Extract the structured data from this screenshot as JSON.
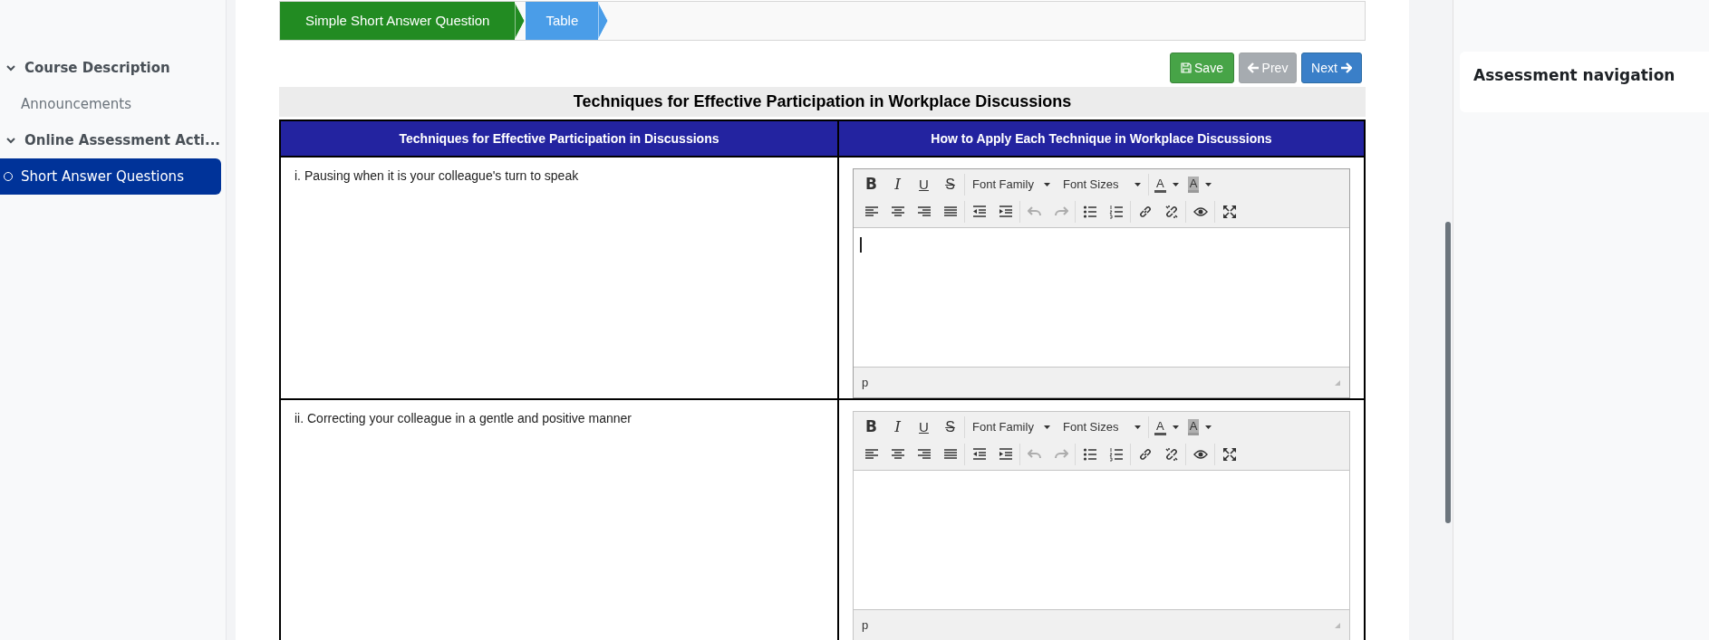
{
  "sidebar": {
    "items": [
      {
        "kind": "section",
        "label": "Course Description",
        "expanded": true
      },
      {
        "kind": "link",
        "label": "Announcements",
        "selected": false
      },
      {
        "kind": "section",
        "label": "Online Assessment Acti...",
        "expanded": true
      },
      {
        "kind": "link",
        "label": "Short Answer Questions",
        "selected": true
      }
    ]
  },
  "breadcrumb": [
    {
      "label": "Simple Short Answer Question",
      "color": "#228b22"
    },
    {
      "label": "Table",
      "color": "#4a9de8"
    }
  ],
  "actions": [
    {
      "kind": "save",
      "label": "Save",
      "disabled": false
    },
    {
      "kind": "prev",
      "label": "Prev",
      "disabled": true
    },
    {
      "kind": "next",
      "label": "Next",
      "disabled": false
    }
  ],
  "table": {
    "title": "Techniques for Effective Participation in Workplace Discussions",
    "columns": [
      "Techniques for Effective Participation in Discussions",
      "How to Apply Each Technique in Workplace Discussions"
    ],
    "rows": [
      {
        "technique": "i. Pausing when it is your colleague's turn to speak",
        "editor": {
          "focused": true,
          "status_path": "p",
          "toolbar": [
            [
              [
                {
                  "kind": "bold",
                  "label": "B",
                  "disabled": false
                },
                {
                  "kind": "italic",
                  "label": "I",
                  "disabled": false
                },
                {
                  "kind": "underline",
                  "label": "U",
                  "disabled": false
                },
                {
                  "kind": "strike",
                  "label": "S",
                  "disabled": false
                }
              ],
              [
                {
                  "kind": "dropdown",
                  "label": "Font Family",
                  "disabled": false
                },
                {
                  "kind": "dropdown",
                  "label": "Font Sizes",
                  "disabled": false
                }
              ],
              [
                {
                  "kind": "text-color",
                  "label": "A",
                  "disabled": false
                },
                {
                  "kind": "back-color",
                  "label": "A",
                  "disabled": false
                }
              ]
            ],
            [
              [
                {
                  "kind": "align-left",
                  "disabled": false
                },
                {
                  "kind": "align-center",
                  "disabled": false
                },
                {
                  "kind": "align-right",
                  "disabled": false
                },
                {
                  "kind": "justify",
                  "disabled": false
                }
              ],
              [
                {
                  "kind": "outdent",
                  "disabled": false
                },
                {
                  "kind": "indent",
                  "disabled": false
                }
              ],
              [
                {
                  "kind": "undo",
                  "disabled": true
                },
                {
                  "kind": "redo",
                  "disabled": true
                }
              ],
              [
                {
                  "kind": "bullet-list",
                  "disabled": false
                },
                {
                  "kind": "numbered-list",
                  "disabled": false
                }
              ],
              [
                {
                  "kind": "link",
                  "disabled": false
                },
                {
                  "kind": "unlink",
                  "disabled": false
                }
              ],
              [
                {
                  "kind": "preview",
                  "disabled": false
                }
              ],
              [
                {
                  "kind": "fullscreen",
                  "disabled": false
                }
              ]
            ]
          ]
        }
      },
      {
        "technique": "ii. Correcting your colleague in a gentle and positive manner",
        "editor": {
          "focused": false,
          "status_path": "p",
          "toolbar": [
            [
              [
                {
                  "kind": "bold",
                  "label": "B",
                  "disabled": false
                },
                {
                  "kind": "italic",
                  "label": "I",
                  "disabled": false
                },
                {
                  "kind": "underline",
                  "label": "U",
                  "disabled": false
                },
                {
                  "kind": "strike",
                  "label": "S",
                  "disabled": false
                }
              ],
              [
                {
                  "kind": "dropdown",
                  "label": "Font Family",
                  "disabled": false
                },
                {
                  "kind": "dropdown",
                  "label": "Font Sizes",
                  "disabled": false
                }
              ],
              [
                {
                  "kind": "text-color",
                  "label": "A",
                  "disabled": false
                },
                {
                  "kind": "back-color",
                  "label": "A",
                  "disabled": false
                }
              ]
            ],
            [
              [
                {
                  "kind": "align-left",
                  "disabled": false
                },
                {
                  "kind": "align-center",
                  "disabled": false
                },
                {
                  "kind": "align-right",
                  "disabled": false
                },
                {
                  "kind": "justify",
                  "disabled": false
                }
              ],
              [
                {
                  "kind": "outdent",
                  "disabled": false
                },
                {
                  "kind": "indent",
                  "disabled": false
                }
              ],
              [
                {
                  "kind": "undo",
                  "disabled": true
                },
                {
                  "kind": "redo",
                  "disabled": true
                }
              ],
              [
                {
                  "kind": "bullet-list",
                  "disabled": false
                },
                {
                  "kind": "numbered-list",
                  "disabled": false
                }
              ],
              [
                {
                  "kind": "link",
                  "disabled": false
                },
                {
                  "kind": "unlink",
                  "disabled": false
                }
              ],
              [
                {
                  "kind": "preview",
                  "disabled": false
                }
              ],
              [
                {
                  "kind": "fullscreen",
                  "disabled": false
                }
              ]
            ]
          ]
        }
      }
    ]
  },
  "right_panel": {
    "title": "Assessment navigation"
  }
}
